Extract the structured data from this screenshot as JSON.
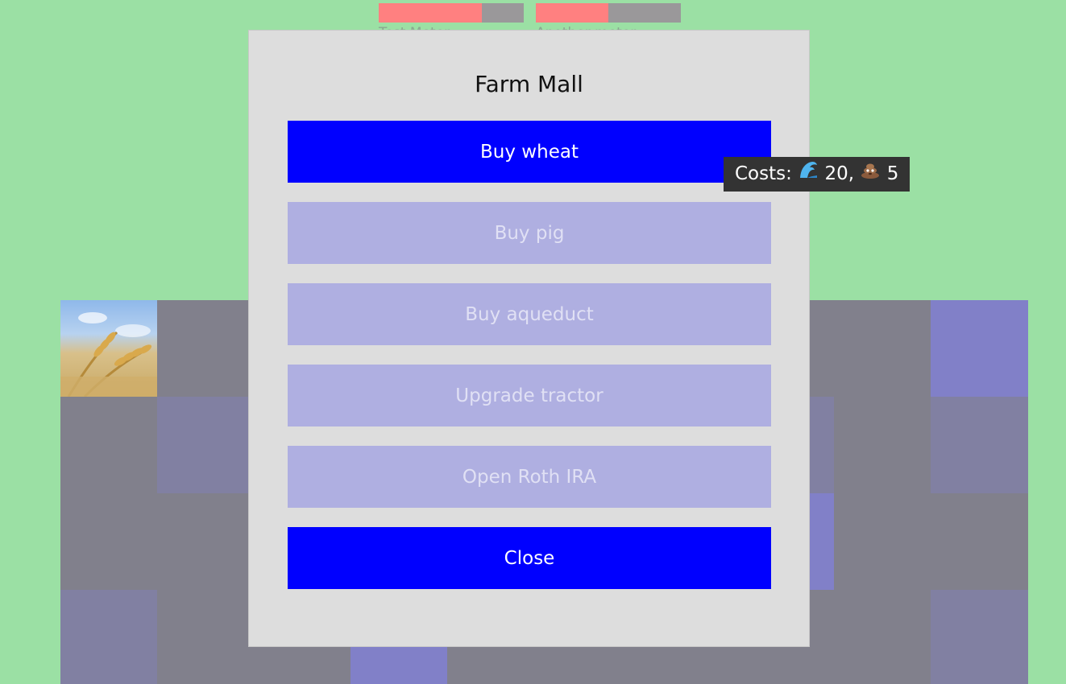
{
  "meters": [
    {
      "label": "Test Meter",
      "fill_fraction": 0.71
    },
    {
      "label": "Another meter",
      "fill_fraction": 0.5
    }
  ],
  "modal": {
    "title": "Farm Mall",
    "buttons": [
      {
        "label": "Buy wheat",
        "enabled": true
      },
      {
        "label": "Buy pig",
        "enabled": false
      },
      {
        "label": "Buy aqueduct",
        "enabled": false
      },
      {
        "label": "Upgrade tractor",
        "enabled": false
      },
      {
        "label": "Open Roth IRA",
        "enabled": false
      }
    ],
    "close_label": "Close"
  },
  "tooltip": {
    "prefix": "Costs:",
    "water_icon": "water-wave-icon",
    "water_cost": "20,",
    "manure_icon": "manure-icon",
    "manure_cost": "5"
  },
  "colors": {
    "background": "#9be0a4",
    "modal_bg": "#dddddd",
    "button_primary": "#0000ff",
    "button_disabled": "#afafe1",
    "meter_fill": "#ff8080",
    "meter_track": "#9a989a",
    "tooltip_bg": "#333333",
    "tile_dirt": "#81808c",
    "tile_water": "#8180c8"
  }
}
